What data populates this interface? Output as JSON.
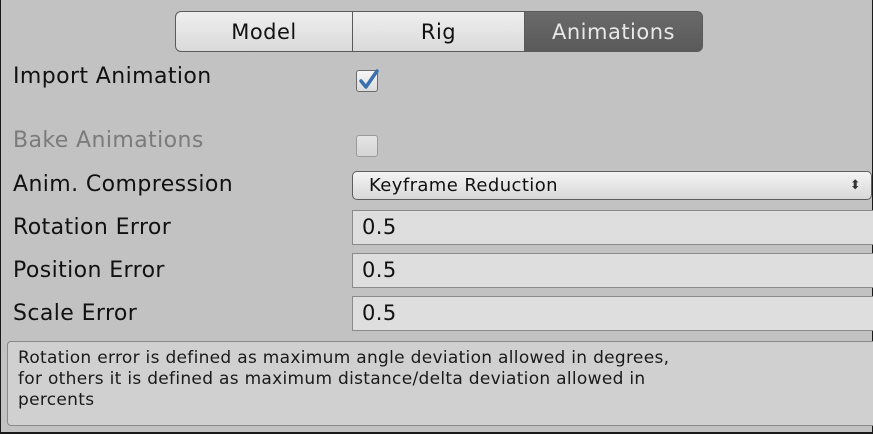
{
  "tabs": [
    {
      "label": "Model"
    },
    {
      "label": "Rig"
    },
    {
      "label": "Animations"
    }
  ],
  "import_animation": {
    "label": "Import Animation",
    "checked": true
  },
  "bake_animations": {
    "label": "Bake Animations",
    "checked": false,
    "enabled": false
  },
  "anim_compression": {
    "label": "Anim. Compression",
    "value": "Keyframe Reduction",
    "arrows": "⬍"
  },
  "rotation_error": {
    "label": "Rotation Error",
    "value": "0.5"
  },
  "position_error": {
    "label": "Position Error",
    "value": "0.5"
  },
  "scale_error": {
    "label": "Scale Error",
    "value": "0.5"
  },
  "help": {
    "lines": [
      "Rotation error is defined as maximum angle deviation allowed in degrees,",
      "for others it is defined as maximum distance/delta deviation allowed in",
      "percents"
    ]
  },
  "colors": {
    "check_mark": "#3a6fb0",
    "selected_tab": "#5f5f5f",
    "panel_bg": "#c2c2c2"
  }
}
